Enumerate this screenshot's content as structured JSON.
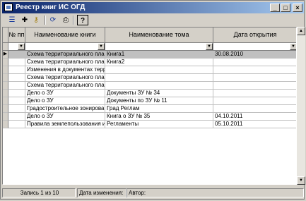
{
  "window": {
    "title": "Реестр книг ИС ОГД"
  },
  "titlebar_buttons": {
    "minimize": "_",
    "maximize": "□",
    "close": "×"
  },
  "toolbar": {
    "tools": [
      {
        "name": "list-icon",
        "glyph": "☰"
      },
      {
        "name": "add-icon",
        "glyph": "✚"
      },
      {
        "name": "key-icon",
        "glyph": "⚷"
      },
      {
        "name": "refresh-icon",
        "glyph": "⟳"
      },
      {
        "name": "print-icon",
        "glyph": "⎙"
      },
      {
        "name": "help-icon",
        "glyph": "?"
      }
    ]
  },
  "grid": {
    "columns": [
      "№ пп",
      "Наименование книги",
      "Наименование тома",
      "Дата открытия"
    ],
    "rows": [
      {
        "num": "",
        "book": "Схема территориального планирования",
        "volume": "Книга1",
        "date": "30.08.2010",
        "selected": true
      },
      {
        "num": "",
        "book": "Схема территориального планирования",
        "volume": "Книга2",
        "date": ""
      },
      {
        "num": "",
        "book": "Изменения в документах территориального планирования",
        "volume": "",
        "date": ""
      },
      {
        "num": "",
        "book": "Схема территориального планирования",
        "volume": "",
        "date": ""
      },
      {
        "num": "",
        "book": "Схема территориального планирования",
        "volume": "",
        "date": ""
      },
      {
        "num": "",
        "book": "Дело о ЗУ",
        "volume": "Документы ЗУ № 34",
        "date": ""
      },
      {
        "num": "",
        "book": "Дело о ЗУ",
        "volume": "Документы по ЗУ № 11",
        "date": ""
      },
      {
        "num": "",
        "book": "Градостроительное зонирование",
        "volume": "Град Реглам",
        "date": ""
      },
      {
        "num": "",
        "book": "Дело о ЗУ",
        "volume": "Книга о ЗУ № 35",
        "date": "04.10.2011"
      },
      {
        "num": "",
        "book": "Правила землепользования и застройки",
        "volume": "Регламенты",
        "date": "05.10.2011"
      }
    ]
  },
  "statusbar": {
    "record": "Запись 1 из 10",
    "changed": "Дата изменения:",
    "author": "Автор:"
  }
}
